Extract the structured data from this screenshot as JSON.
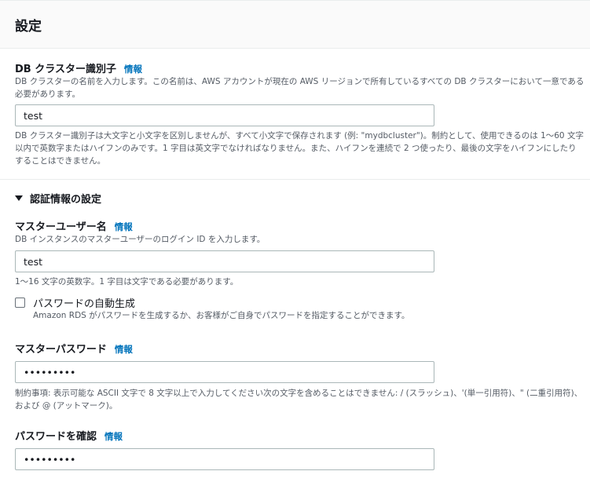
{
  "settings": {
    "title": "設定",
    "cluster_identifier": {
      "label": "DB クラスター識別子",
      "info": "情報",
      "description": "DB クラスターの名前を入力します。この名前は、AWS アカウントが現在の AWS リージョンで所有しているすべての DB クラスターにおいて一意である必要があります。",
      "value": "test",
      "constraint": "DB クラスター識別子は大文字と小文字を区別しませんが、すべて小文字で保存されます (例: \"mydbcluster\")。制約として、使用できるのは 1〜60 文字以内で英数字またはハイフンのみです。1 字目は英文字でなければなりません。また、ハイフンを連続で 2 つ使ったり、最後の文字をハイフンにしたりすることはできません。"
    },
    "credentials": {
      "section_title": "認証情報の設定",
      "expanded": true,
      "master_username": {
        "label": "マスターユーザー名",
        "info": "情報",
        "description": "DB インスタンスのマスターユーザーのログイン ID を入力します。",
        "value": "test",
        "constraint": "1〜16 文字の英数字。1 字目は文字である必要があります。"
      },
      "auto_generate": {
        "label": "パスワードの自動生成",
        "checked": false,
        "description": "Amazon RDS がパスワードを生成するか、お客様がご自身でパスワードを指定することができます。"
      },
      "master_password": {
        "label": "マスターパスワード",
        "info": "情報",
        "value": "•••••••••",
        "constraint": "制約事項: 表示可能な ASCII 文字で 8 文字以上で入力してください次の文字を含めることはできません: / (スラッシュ)、'(単一引用符)、\" (二重引用符)、および @ (アットマーク)。"
      },
      "confirm_password": {
        "label": "パスワードを確認",
        "info": "情報",
        "value": "•••••••••"
      }
    }
  },
  "colors": {
    "link": "#0073bb",
    "text": "#16191f",
    "secondary_text": "#545b64",
    "input_border": "#aab7b8",
    "header_bg": "#fafafa"
  }
}
